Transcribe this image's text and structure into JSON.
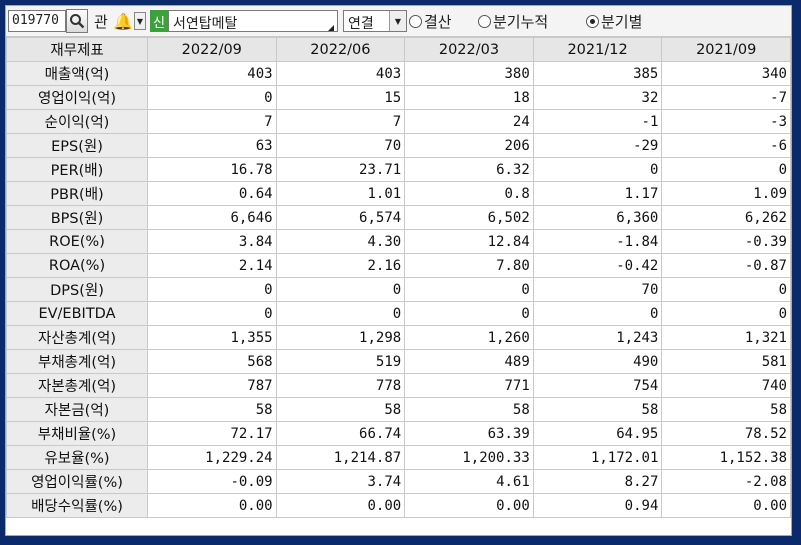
{
  "toolbar": {
    "stock_code": "019770",
    "gwan_label": "관",
    "sin_badge": "신",
    "company_name": "서연탑메탈",
    "consolidation": "연결",
    "radio_settlement": "결산",
    "radio_quarter_cum": "분기누적",
    "radio_quarter": "분기별",
    "selected_radio": "분기별"
  },
  "table": {
    "corner_header": "재무제표",
    "columns": [
      "2022/09",
      "2022/06",
      "2022/03",
      "2021/12",
      "2021/09"
    ],
    "rows": [
      {
        "label": "매출액(억)",
        "values": [
          "403",
          "403",
          "380",
          "385",
          "340"
        ]
      },
      {
        "label": "영업이익(억)",
        "values": [
          "0",
          "15",
          "18",
          "32",
          "-7"
        ]
      },
      {
        "label": "순이익(억)",
        "values": [
          "7",
          "7",
          "24",
          "-1",
          "-3"
        ]
      },
      {
        "label": "EPS(원)",
        "values": [
          "63",
          "70",
          "206",
          "-29",
          "-6"
        ]
      },
      {
        "label": "PER(배)",
        "values": [
          "16.78",
          "23.71",
          "6.32",
          "0",
          "0"
        ]
      },
      {
        "label": "PBR(배)",
        "values": [
          "0.64",
          "1.01",
          "0.8",
          "1.17",
          "1.09"
        ]
      },
      {
        "label": "BPS(원)",
        "values": [
          "6,646",
          "6,574",
          "6,502",
          "6,360",
          "6,262"
        ]
      },
      {
        "label": "ROE(%)",
        "values": [
          "3.84",
          "4.30",
          "12.84",
          "-1.84",
          "-0.39"
        ]
      },
      {
        "label": "ROA(%)",
        "values": [
          "2.14",
          "2.16",
          "7.80",
          "-0.42",
          "-0.87"
        ]
      },
      {
        "label": "DPS(원)",
        "values": [
          "0",
          "0",
          "0",
          "70",
          "0"
        ]
      },
      {
        "label": "EV/EBITDA",
        "values": [
          "0",
          "0",
          "0",
          "0",
          "0"
        ]
      },
      {
        "label": "자산총계(억)",
        "values": [
          "1,355",
          "1,298",
          "1,260",
          "1,243",
          "1,321"
        ]
      },
      {
        "label": "부채총계(억)",
        "values": [
          "568",
          "519",
          "489",
          "490",
          "581"
        ]
      },
      {
        "label": "자본총계(억)",
        "values": [
          "787",
          "778",
          "771",
          "754",
          "740"
        ]
      },
      {
        "label": "자본금(억)",
        "values": [
          "58",
          "58",
          "58",
          "58",
          "58"
        ]
      },
      {
        "label": "부채비율(%)",
        "values": [
          "72.17",
          "66.74",
          "63.39",
          "64.95",
          "78.52"
        ]
      },
      {
        "label": "유보율(%)",
        "values": [
          "1,229.24",
          "1,214.87",
          "1,200.33",
          "1,172.01",
          "1,152.38"
        ]
      },
      {
        "label": "영업이익률(%)",
        "values": [
          "-0.09",
          "3.74",
          "4.61",
          "8.27",
          "-2.08"
        ]
      },
      {
        "label": "배당수익률(%)",
        "values": [
          "0.00",
          "0.00",
          "0.00",
          "0.94",
          "0.00"
        ]
      }
    ]
  }
}
